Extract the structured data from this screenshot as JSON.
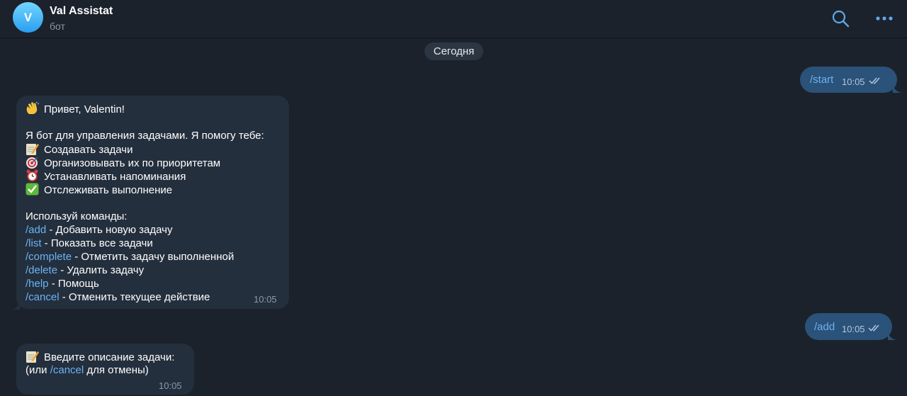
{
  "header": {
    "avatar_letter": "V",
    "title": "Val Assistat",
    "status": "бот",
    "search_icon": "search-icon",
    "more_icon": "more-dots-icon"
  },
  "date_separator": "Сегодня",
  "messages": {
    "start": {
      "text": "/start",
      "time": "10:05",
      "status": "read"
    },
    "welcome": {
      "greeting": "Привет, Valentin!",
      "greeting_emoji": "waving-hand",
      "intro": "Я бот для управления задачами. Я помогу тебе:",
      "features": [
        {
          "emoji": "memo",
          "text": "Создавать задачи"
        },
        {
          "emoji": "direct-hit",
          "text": "Организовывать их по приоритетам"
        },
        {
          "emoji": "alarm-clock",
          "text": "Устанавливать напоминания"
        },
        {
          "emoji": "check-mark-button",
          "text": "Отслеживать выполнение"
        }
      ],
      "commands_title": "Используй команды:",
      "commands": [
        {
          "cmd": "/add",
          "desc": " - Добавить новую задачу"
        },
        {
          "cmd": "/list",
          "desc": " - Показать все задачи"
        },
        {
          "cmd": "/complete",
          "desc": " - Отметить задачу выполненной"
        },
        {
          "cmd": "/delete",
          "desc": " - Удалить задачу"
        },
        {
          "cmd": "/help",
          "desc": " - Помощь"
        },
        {
          "cmd": "/cancel",
          "desc": " - Отменить текущее действие"
        }
      ],
      "time": "10:05"
    },
    "add": {
      "text": "/add",
      "time": "10:05",
      "status": "read"
    },
    "prompt": {
      "emoji": "memo",
      "line1": "Введите описание задачи:",
      "line2_prefix": "(или ",
      "line2_cmd": "/cancel",
      "line2_suffix": " для отмены)",
      "time": "10:05"
    }
  },
  "colors": {
    "background": "#1b222c",
    "incoming_bubble": "#242f3d",
    "outgoing_bubble": "#2b5278",
    "link": "#6ab3f3",
    "accent": "#5fa8e8"
  }
}
